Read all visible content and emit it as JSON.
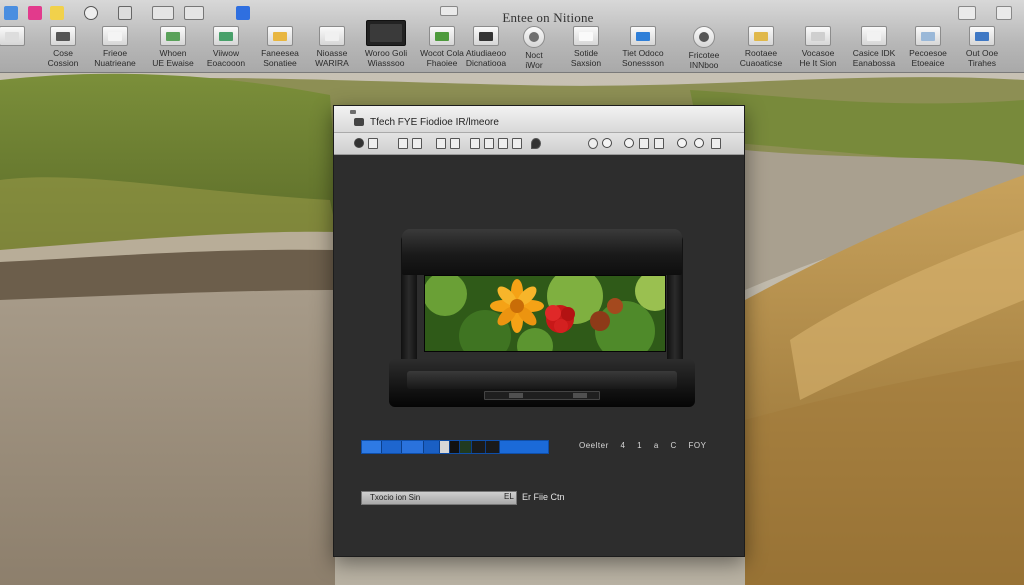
{
  "toolbar": {
    "title": "Entee on Nitione",
    "tools": [
      {
        "label": ""
      },
      {
        "label": "Cose\nCossion"
      },
      {
        "label": "Frieoe\nNuatrieane"
      },
      {
        "label": "Whoen\nUE Ewaise"
      },
      {
        "label": "Viiwow\nEoacooon"
      },
      {
        "label": "Faneesea\nSonatiee"
      },
      {
        "label": "Nioasse\nWARIRA"
      },
      {
        "label": "Woroo Goli\nWiasssoo"
      },
      {
        "label": "Wocot Cola\nFhaoiee"
      },
      {
        "label": "Atiudiaeoo\nDicnatiooa"
      },
      {
        "label": "Noct\niWor"
      },
      {
        "label": "Sotide\nSaxsion"
      },
      {
        "label": "Tiet Odoco\nSonessson"
      },
      {
        "label": "Fricotee\nINNboo"
      },
      {
        "label": "Rootaee\nCuaoaticse"
      },
      {
        "label": "Vocasoe\nHe It Sion"
      },
      {
        "label": "Casice IDK\nEanabossa"
      },
      {
        "label": "Pecoesoe\nEtoeaice"
      },
      {
        "label": "Out Ooe\nTirahes"
      }
    ]
  },
  "window": {
    "title": "Tfech FYE Fiodioe IR/lmeore"
  },
  "controls": {
    "readout": [
      "Oeelter",
      "4",
      "1",
      "a",
      "C",
      "FOY"
    ],
    "file_field": "Txocio ion Sin",
    "file_field_end": "EL",
    "file_size": "Er Fiie Ctn"
  },
  "colors": {
    "accent_blue": "#1b6ad8",
    "window_bg": "#2d2d2d",
    "toolbar_bg": "#c4c4c4",
    "flower_orange": "#f5a216",
    "flower_red": "#d41e1e"
  },
  "icons": [
    "search-icon",
    "gear-icon",
    "camera-icon",
    "image-icon",
    "folder-icon",
    "monitor-icon"
  ]
}
